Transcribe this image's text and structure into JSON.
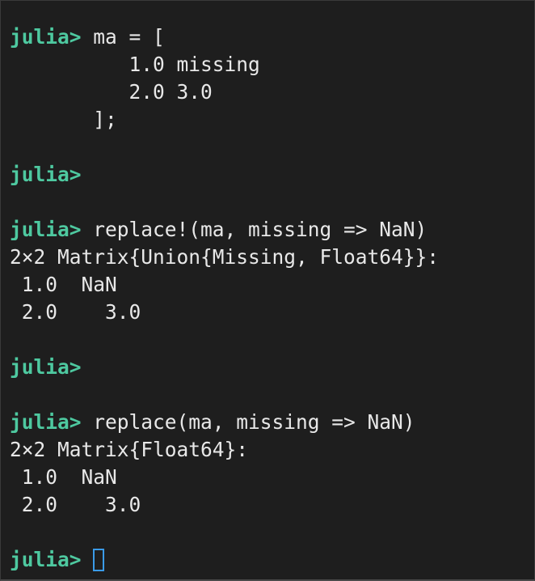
{
  "accent": {
    "prompt_color": "#4ec9a0",
    "cursor_color": "#3a9be8",
    "background": "#1e1e1e",
    "text_color": "#e8e8e8"
  },
  "terminal": {
    "prompt": "julia>",
    "lines": [
      {
        "prompt": true,
        "text": " ma = ["
      },
      {
        "prompt": false,
        "text": "          1.0 missing"
      },
      {
        "prompt": false,
        "text": "          2.0 3.0"
      },
      {
        "prompt": false,
        "text": "       ];"
      },
      {
        "prompt": false,
        "text": ""
      },
      {
        "prompt": true,
        "text": ""
      },
      {
        "prompt": false,
        "text": ""
      },
      {
        "prompt": true,
        "text": " replace!(ma, missing => NaN)"
      },
      {
        "prompt": false,
        "text": "2×2 Matrix{Union{Missing, Float64}}:"
      },
      {
        "prompt": false,
        "text": " 1.0  NaN"
      },
      {
        "prompt": false,
        "text": " 2.0    3.0"
      },
      {
        "prompt": false,
        "text": ""
      },
      {
        "prompt": true,
        "text": ""
      },
      {
        "prompt": false,
        "text": ""
      },
      {
        "prompt": true,
        "text": " replace(ma, missing => NaN)"
      },
      {
        "prompt": false,
        "text": "2×2 Matrix{Float64}:"
      },
      {
        "prompt": false,
        "text": " 1.0  NaN"
      },
      {
        "prompt": false,
        "text": " 2.0    3.0"
      },
      {
        "prompt": false,
        "text": ""
      },
      {
        "prompt": true,
        "text": " ",
        "cursor": true
      }
    ]
  }
}
